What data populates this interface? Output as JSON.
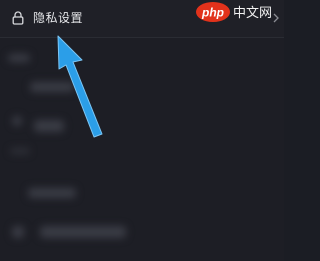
{
  "settings_row": {
    "icon": "lock-icon",
    "label": "隐私设置",
    "chevron_icon": "chevron-right-icon"
  },
  "watermark": {
    "logo_text": "php",
    "site_text": "中文网"
  },
  "arrow": {
    "icon": "arrow-icon",
    "color": "#2b9ee8"
  }
}
